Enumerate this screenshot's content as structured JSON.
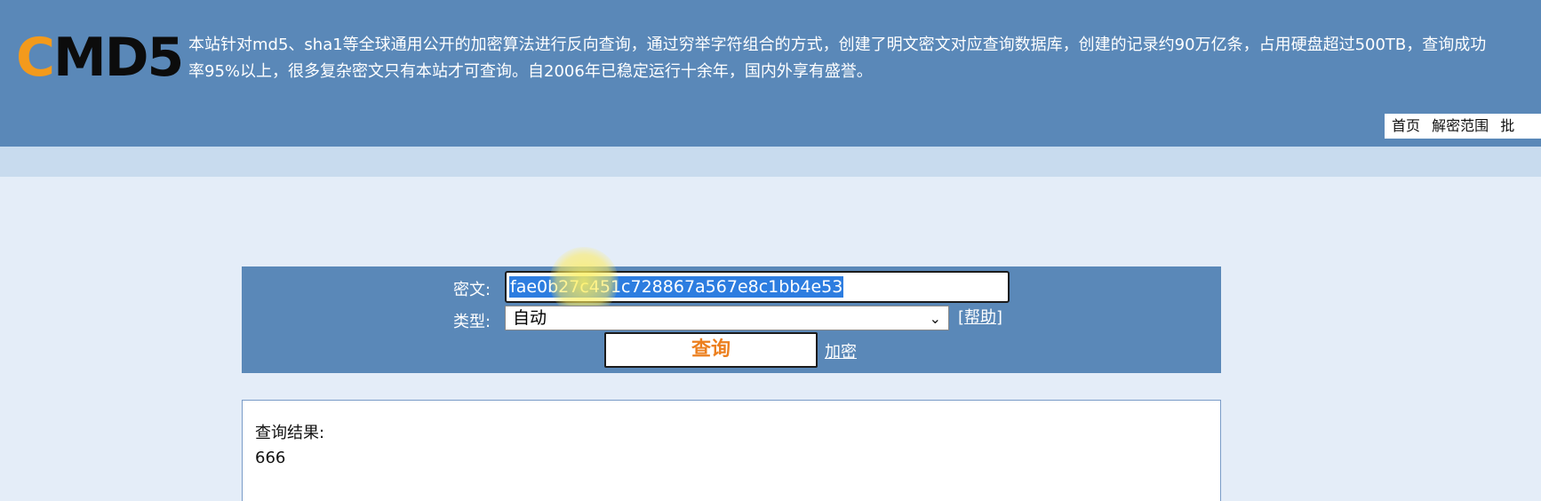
{
  "header": {
    "logo_letter": "C",
    "logo_rest": "MD5",
    "intro": "本站针对md5、sha1等全球通用公开的加密算法进行反向查询，通过穷举字符组合的方式，创建了明文密文对应查询数据库，创建的记录约90万亿条，占用硬盘超过500TB，查询成功率95%以上，很多复杂密文只有本站才可查询。自2006年已稳定运行十余年，国内外享有盛誉。",
    "nav": [
      "首页",
      "解密范围",
      "批"
    ]
  },
  "form": {
    "cipher_label": "密文:",
    "cipher_value": "fae0b27c451c728867a567e8c1bb4e53",
    "type_label": "类型:",
    "type_value": "自动",
    "help_open": "[",
    "help_text": "帮助",
    "help_close": "]",
    "query_button": "查询",
    "encrypt_link": "加密"
  },
  "result": {
    "label": "查询结果:",
    "value": "666"
  },
  "colors": {
    "header_bg": "#5a88b8",
    "logo_accent": "#f39a1c",
    "button_text": "#ec7f1e",
    "selection": "#2d7de0"
  }
}
